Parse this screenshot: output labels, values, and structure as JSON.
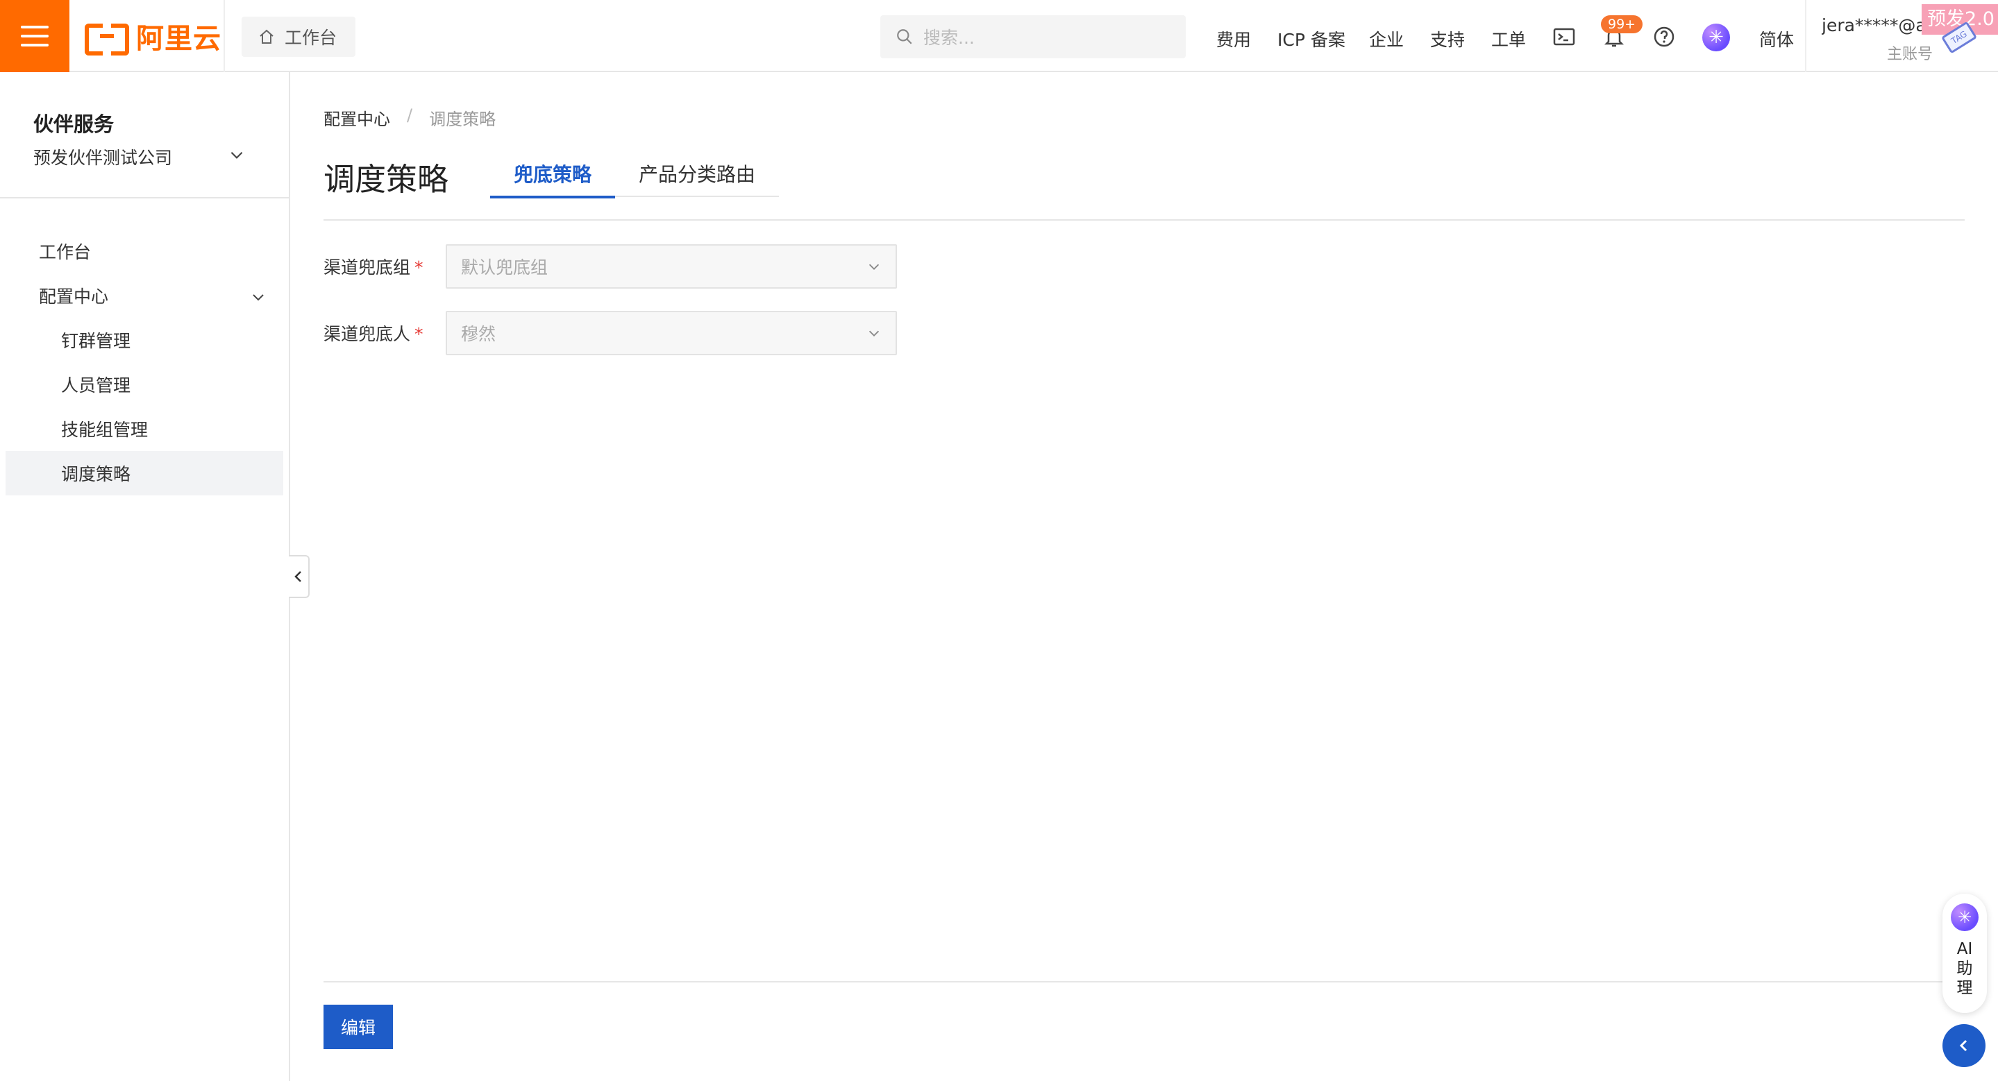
{
  "brand": {
    "logo_text": "阿里云",
    "accent": "#ff6a00"
  },
  "topbar": {
    "home_label": "工作台",
    "search_placeholder": "搜索...",
    "nav": [
      "费用",
      "ICP 备案",
      "企业",
      "支持",
      "工单"
    ],
    "notification_count": "99+",
    "language": "简体",
    "user_name": "jera*****@al...",
    "user_role": "主账号",
    "env_tag": "预发2.0",
    "env_mini_tag": "TAG"
  },
  "sidebar": {
    "title": "伙伴服务",
    "company": "预发伙伴测试公司",
    "items": [
      {
        "label": "工作台"
      },
      {
        "label": "配置中心"
      },
      {
        "label": "钉群管理"
      },
      {
        "label": "人员管理"
      },
      {
        "label": "技能组管理"
      },
      {
        "label": "调度策略"
      }
    ]
  },
  "main": {
    "breadcrumb": [
      "配置中心",
      "/",
      "调度策略"
    ],
    "title": "调度策略",
    "tabs": [
      {
        "label": "兜底策略",
        "active": true
      },
      {
        "label": "产品分类路由",
        "active": false
      }
    ],
    "form": [
      {
        "label": "渠道兜底组",
        "required": "*",
        "value": "默认兜底组"
      },
      {
        "label": "渠道兜底人",
        "required": "*",
        "value": "穆然"
      }
    ],
    "edit_button": "编辑"
  },
  "ai_assistant": {
    "label": "AI 助 理"
  },
  "colors": {
    "primary": "#1e5cc8",
    "required": "#e53935",
    "badge": "#f6742e",
    "env_tag": "#f7a1b6"
  }
}
